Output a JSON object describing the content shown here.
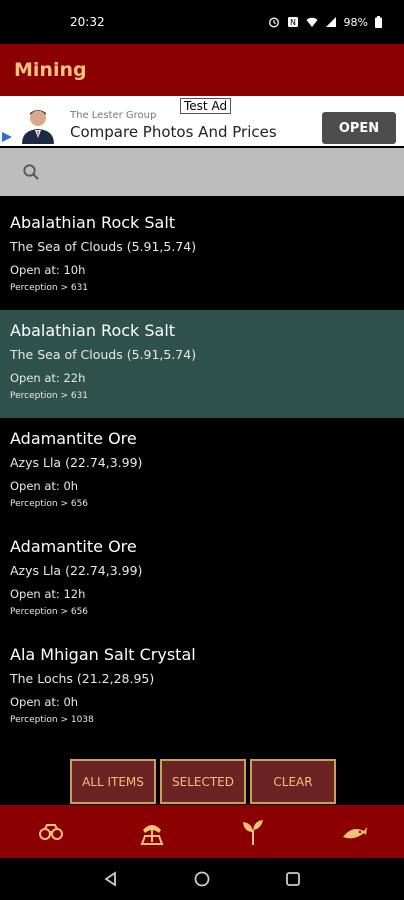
{
  "status": {
    "time": "20:32",
    "battery": "98%"
  },
  "appbar": {
    "title": "Mining"
  },
  "ad": {
    "test_label": "Test Ad",
    "advertiser": "The Lester Group",
    "headline": "Compare Photos And Prices",
    "cta": "OPEN"
  },
  "search": {
    "placeholder": ""
  },
  "items": [
    {
      "name": "Abalathian Rock Salt",
      "location": "The Sea of Clouds (5.91,5.74)",
      "open": "Open at: 10h",
      "perception": "Perception > 631",
      "selected": false
    },
    {
      "name": "Abalathian Rock Salt",
      "location": "The Sea of Clouds (5.91,5.74)",
      "open": "Open at: 22h",
      "perception": "Perception > 631",
      "selected": true
    },
    {
      "name": "Adamantite Ore",
      "location": "Azys Lla (22.74,3.99)",
      "open": "Open at: 0h",
      "perception": "Perception > 656",
      "selected": false
    },
    {
      "name": "Adamantite Ore",
      "location": "Azys Lla (22.74,3.99)",
      "open": "Open at: 12h",
      "perception": "Perception > 656",
      "selected": false
    },
    {
      "name": "Ala Mhigan Salt Crystal",
      "location": "The Lochs (21.2,28.95)",
      "open": "Open at: 0h",
      "perception": "Perception > 1038",
      "selected": false
    }
  ],
  "filters": {
    "all": "ALL ITEMS",
    "selected": "SELECTED",
    "clear": "CLEAR"
  },
  "colors": {
    "appbar": "#8b0000",
    "title": "#f2c27b",
    "selected_row": "#2f534c",
    "button_border": "#c8a05a"
  },
  "nav_icons": [
    "binoculars-icon",
    "mining-icon",
    "botany-icon",
    "fishing-icon"
  ]
}
